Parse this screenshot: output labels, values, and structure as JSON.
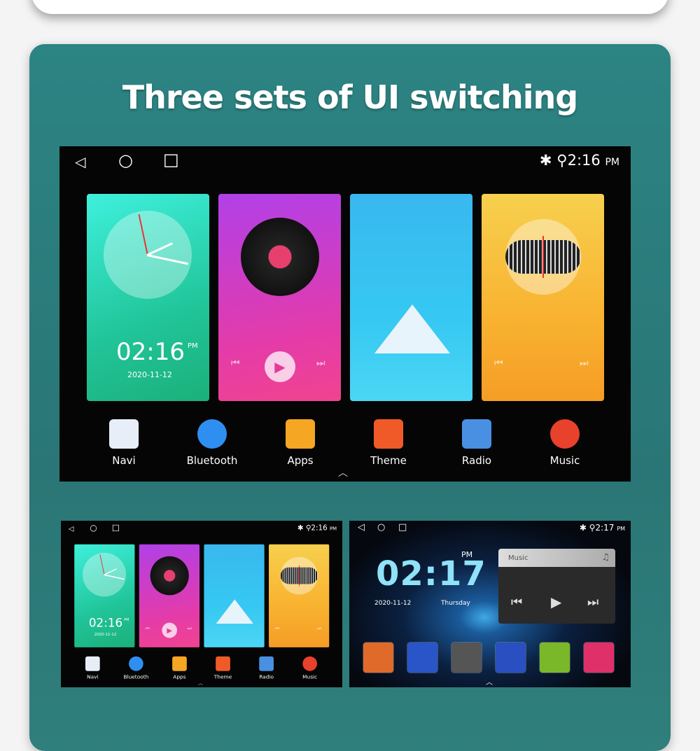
{
  "headline": "Three sets of UI switching",
  "home": {
    "nav": {
      "back": "◁",
      "home": "○",
      "recent": "□"
    },
    "status": {
      "time": "2:16",
      "ampm": "PM",
      "bluetooth": "bluetooth-icon",
      "location": "location-icon"
    },
    "clock": {
      "time": "02:16",
      "ampm": "PM",
      "date": "2020-11-12"
    },
    "dock": [
      {
        "label": "Navi",
        "icon": "navi-icon",
        "color": "#e8eef8"
      },
      {
        "label": "Bluetooth",
        "icon": "bluetooth-phone-icon",
        "color": "#2f8ff0"
      },
      {
        "label": "Apps",
        "icon": "apps-icon",
        "color": "#f5a623"
      },
      {
        "label": "Theme",
        "icon": "theme-brush-icon",
        "color": "#f05a28"
      },
      {
        "label": "Radio",
        "icon": "radio-icon",
        "color": "#4a90e2"
      },
      {
        "label": "Music",
        "icon": "music-icon",
        "color": "#e8412c"
      }
    ]
  },
  "music_ui": {
    "nav": {
      "back": "◁",
      "home": "○",
      "recent": "□"
    },
    "status": {
      "time": "2:17",
      "ampm": "PM"
    },
    "clock": {
      "time": "02:17",
      "ampm": "PM",
      "date": "2020-11-12",
      "day": "Thursday"
    },
    "widget": {
      "title": "Music",
      "prev": "⏮",
      "play": "▶",
      "next": "⏭"
    },
    "dock_icons": [
      {
        "icon": "navi-icon",
        "color": "#e06a2a"
      },
      {
        "icon": "bluetooth-phone-icon",
        "color": "#2a55c8"
      },
      {
        "icon": "apps-icon",
        "color": "#555555"
      },
      {
        "icon": "theme-brush-icon",
        "color": "#2a4fc0"
      },
      {
        "icon": "radio-icon",
        "color": "#7ab829"
      },
      {
        "icon": "music-icon",
        "color": "#e0306a"
      }
    ]
  }
}
